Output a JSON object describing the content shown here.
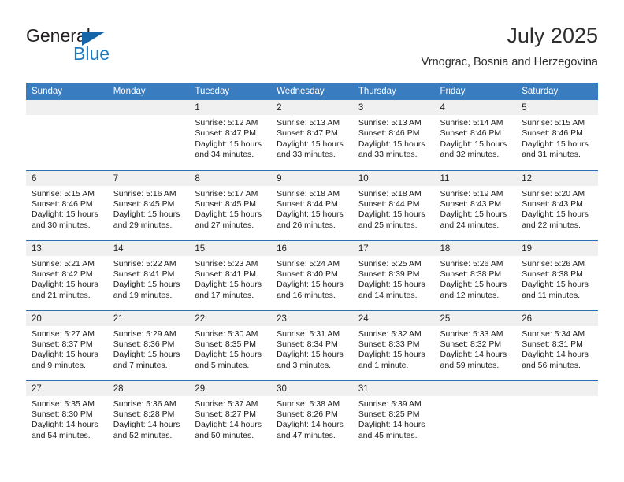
{
  "brand": {
    "name_top": "General",
    "name_bottom": "Blue",
    "accent_color": "#1f7bc1",
    "triangle_color": "#1565a8"
  },
  "header": {
    "title": "July 2025",
    "subtitle": "Vrnograc, Bosnia and Herzegovina"
  },
  "theme": {
    "header_row_color": "#3a7cc0",
    "row_divider_color": "#2d6fb3",
    "daynum_band_color": "#f0f0f0"
  },
  "weekdays": [
    "Sunday",
    "Monday",
    "Tuesday",
    "Wednesday",
    "Thursday",
    "Friday",
    "Saturday"
  ],
  "weeks": [
    [
      {
        "day": "",
        "empty": true
      },
      {
        "day": "",
        "empty": true
      },
      {
        "day": "1",
        "sunrise": "Sunrise: 5:12 AM",
        "sunset": "Sunset: 8:47 PM",
        "daylight1": "Daylight: 15 hours",
        "daylight2": "and 34 minutes."
      },
      {
        "day": "2",
        "sunrise": "Sunrise: 5:13 AM",
        "sunset": "Sunset: 8:47 PM",
        "daylight1": "Daylight: 15 hours",
        "daylight2": "and 33 minutes."
      },
      {
        "day": "3",
        "sunrise": "Sunrise: 5:13 AM",
        "sunset": "Sunset: 8:46 PM",
        "daylight1": "Daylight: 15 hours",
        "daylight2": "and 33 minutes."
      },
      {
        "day": "4",
        "sunrise": "Sunrise: 5:14 AM",
        "sunset": "Sunset: 8:46 PM",
        "daylight1": "Daylight: 15 hours",
        "daylight2": "and 32 minutes."
      },
      {
        "day": "5",
        "sunrise": "Sunrise: 5:15 AM",
        "sunset": "Sunset: 8:46 PM",
        "daylight1": "Daylight: 15 hours",
        "daylight2": "and 31 minutes."
      }
    ],
    [
      {
        "day": "6",
        "sunrise": "Sunrise: 5:15 AM",
        "sunset": "Sunset: 8:46 PM",
        "daylight1": "Daylight: 15 hours",
        "daylight2": "and 30 minutes."
      },
      {
        "day": "7",
        "sunrise": "Sunrise: 5:16 AM",
        "sunset": "Sunset: 8:45 PM",
        "daylight1": "Daylight: 15 hours",
        "daylight2": "and 29 minutes."
      },
      {
        "day": "8",
        "sunrise": "Sunrise: 5:17 AM",
        "sunset": "Sunset: 8:45 PM",
        "daylight1": "Daylight: 15 hours",
        "daylight2": "and 27 minutes."
      },
      {
        "day": "9",
        "sunrise": "Sunrise: 5:18 AM",
        "sunset": "Sunset: 8:44 PM",
        "daylight1": "Daylight: 15 hours",
        "daylight2": "and 26 minutes."
      },
      {
        "day": "10",
        "sunrise": "Sunrise: 5:18 AM",
        "sunset": "Sunset: 8:44 PM",
        "daylight1": "Daylight: 15 hours",
        "daylight2": "and 25 minutes."
      },
      {
        "day": "11",
        "sunrise": "Sunrise: 5:19 AM",
        "sunset": "Sunset: 8:43 PM",
        "daylight1": "Daylight: 15 hours",
        "daylight2": "and 24 minutes."
      },
      {
        "day": "12",
        "sunrise": "Sunrise: 5:20 AM",
        "sunset": "Sunset: 8:43 PM",
        "daylight1": "Daylight: 15 hours",
        "daylight2": "and 22 minutes."
      }
    ],
    [
      {
        "day": "13",
        "sunrise": "Sunrise: 5:21 AM",
        "sunset": "Sunset: 8:42 PM",
        "daylight1": "Daylight: 15 hours",
        "daylight2": "and 21 minutes."
      },
      {
        "day": "14",
        "sunrise": "Sunrise: 5:22 AM",
        "sunset": "Sunset: 8:41 PM",
        "daylight1": "Daylight: 15 hours",
        "daylight2": "and 19 minutes."
      },
      {
        "day": "15",
        "sunrise": "Sunrise: 5:23 AM",
        "sunset": "Sunset: 8:41 PM",
        "daylight1": "Daylight: 15 hours",
        "daylight2": "and 17 minutes."
      },
      {
        "day": "16",
        "sunrise": "Sunrise: 5:24 AM",
        "sunset": "Sunset: 8:40 PM",
        "daylight1": "Daylight: 15 hours",
        "daylight2": "and 16 minutes."
      },
      {
        "day": "17",
        "sunrise": "Sunrise: 5:25 AM",
        "sunset": "Sunset: 8:39 PM",
        "daylight1": "Daylight: 15 hours",
        "daylight2": "and 14 minutes."
      },
      {
        "day": "18",
        "sunrise": "Sunrise: 5:26 AM",
        "sunset": "Sunset: 8:38 PM",
        "daylight1": "Daylight: 15 hours",
        "daylight2": "and 12 minutes."
      },
      {
        "day": "19",
        "sunrise": "Sunrise: 5:26 AM",
        "sunset": "Sunset: 8:38 PM",
        "daylight1": "Daylight: 15 hours",
        "daylight2": "and 11 minutes."
      }
    ],
    [
      {
        "day": "20",
        "sunrise": "Sunrise: 5:27 AM",
        "sunset": "Sunset: 8:37 PM",
        "daylight1": "Daylight: 15 hours",
        "daylight2": "and 9 minutes."
      },
      {
        "day": "21",
        "sunrise": "Sunrise: 5:29 AM",
        "sunset": "Sunset: 8:36 PM",
        "daylight1": "Daylight: 15 hours",
        "daylight2": "and 7 minutes."
      },
      {
        "day": "22",
        "sunrise": "Sunrise: 5:30 AM",
        "sunset": "Sunset: 8:35 PM",
        "daylight1": "Daylight: 15 hours",
        "daylight2": "and 5 minutes."
      },
      {
        "day": "23",
        "sunrise": "Sunrise: 5:31 AM",
        "sunset": "Sunset: 8:34 PM",
        "daylight1": "Daylight: 15 hours",
        "daylight2": "and 3 minutes."
      },
      {
        "day": "24",
        "sunrise": "Sunrise: 5:32 AM",
        "sunset": "Sunset: 8:33 PM",
        "daylight1": "Daylight: 15 hours",
        "daylight2": "and 1 minute."
      },
      {
        "day": "25",
        "sunrise": "Sunrise: 5:33 AM",
        "sunset": "Sunset: 8:32 PM",
        "daylight1": "Daylight: 14 hours",
        "daylight2": "and 59 minutes."
      },
      {
        "day": "26",
        "sunrise": "Sunrise: 5:34 AM",
        "sunset": "Sunset: 8:31 PM",
        "daylight1": "Daylight: 14 hours",
        "daylight2": "and 56 minutes."
      }
    ],
    [
      {
        "day": "27",
        "sunrise": "Sunrise: 5:35 AM",
        "sunset": "Sunset: 8:30 PM",
        "daylight1": "Daylight: 14 hours",
        "daylight2": "and 54 minutes."
      },
      {
        "day": "28",
        "sunrise": "Sunrise: 5:36 AM",
        "sunset": "Sunset: 8:28 PM",
        "daylight1": "Daylight: 14 hours",
        "daylight2": "and 52 minutes."
      },
      {
        "day": "29",
        "sunrise": "Sunrise: 5:37 AM",
        "sunset": "Sunset: 8:27 PM",
        "daylight1": "Daylight: 14 hours",
        "daylight2": "and 50 minutes."
      },
      {
        "day": "30",
        "sunrise": "Sunrise: 5:38 AM",
        "sunset": "Sunset: 8:26 PM",
        "daylight1": "Daylight: 14 hours",
        "daylight2": "and 47 minutes."
      },
      {
        "day": "31",
        "sunrise": "Sunrise: 5:39 AM",
        "sunset": "Sunset: 8:25 PM",
        "daylight1": "Daylight: 14 hours",
        "daylight2": "and 45 minutes."
      },
      {
        "day": "",
        "empty": true
      },
      {
        "day": "",
        "empty": true
      }
    ]
  ]
}
